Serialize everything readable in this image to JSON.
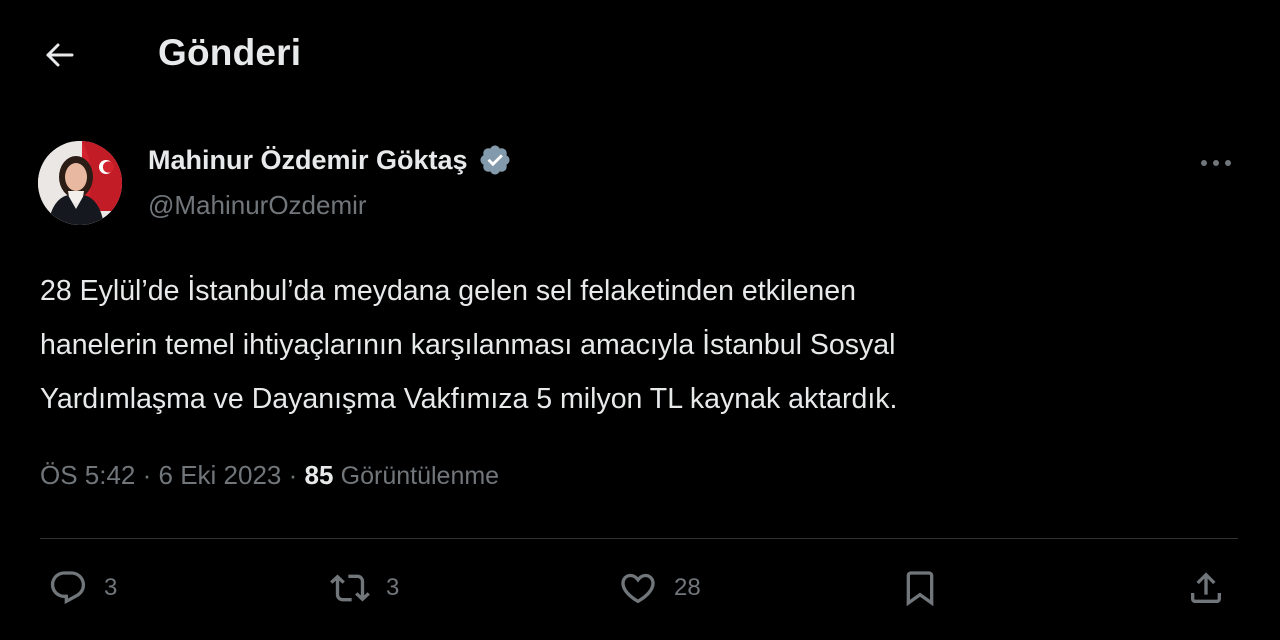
{
  "header": {
    "back_icon": "arrow-left-icon",
    "title": "Gönderi"
  },
  "author": {
    "name": "Mahinur Özdemir Göktaş",
    "handle": "@MahinurOzdemir",
    "verified": true,
    "verified_color": "#829aab"
  },
  "tweet": {
    "lines": [
      "28 Eylül’de İstanbul’da meydana gelen sel felaketinden etkilenen",
      "hanelerin temel ihtiyaçlarının karşılanması amacıyla İstanbul Sosyal",
      "Yardımlaşma ve Dayanışma Vakfımıza 5 milyon TL kaynak aktardık."
    ]
  },
  "meta": {
    "time": "ÖS 5:42",
    "separator": " · ",
    "date": "6 Eki 2023",
    "views_count": "85",
    "views_label": "Görüntülenme"
  },
  "actions": {
    "reply_count": "3",
    "retweet_count": "3",
    "like_count": "28"
  },
  "colors": {
    "background": "#000000",
    "text_primary": "#e7e9ea",
    "text_secondary": "#71767b",
    "divider": "#2f3336"
  }
}
